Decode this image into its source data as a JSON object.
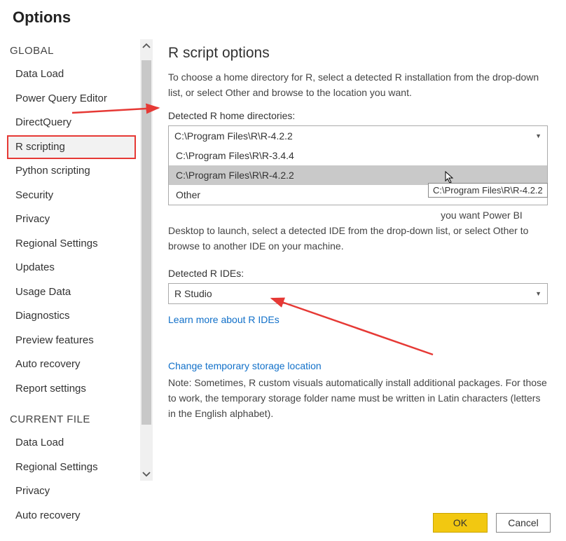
{
  "window_title": "Options",
  "sidebar": {
    "sections": [
      {
        "header": "GLOBAL",
        "items": [
          {
            "label": "Data Load",
            "selected": false
          },
          {
            "label": "Power Query Editor",
            "selected": false
          },
          {
            "label": "DirectQuery",
            "selected": false
          },
          {
            "label": "R scripting",
            "selected": true
          },
          {
            "label": "Python scripting",
            "selected": false
          },
          {
            "label": "Security",
            "selected": false
          },
          {
            "label": "Privacy",
            "selected": false
          },
          {
            "label": "Regional Settings",
            "selected": false
          },
          {
            "label": "Updates",
            "selected": false
          },
          {
            "label": "Usage Data",
            "selected": false
          },
          {
            "label": "Diagnostics",
            "selected": false
          },
          {
            "label": "Preview features",
            "selected": false
          },
          {
            "label": "Auto recovery",
            "selected": false
          },
          {
            "label": "Report settings",
            "selected": false
          }
        ]
      },
      {
        "header": "CURRENT FILE",
        "items": [
          {
            "label": "Data Load",
            "selected": false
          },
          {
            "label": "Regional Settings",
            "selected": false
          },
          {
            "label": "Privacy",
            "selected": false
          },
          {
            "label": "Auto recovery",
            "selected": false
          }
        ]
      }
    ]
  },
  "panel": {
    "title": "R script options",
    "intro": "To choose a home directory for R, select a detected R installation from the drop-down list, or select Other and browse to the location you want.",
    "home_dir_label": "Detected R home directories:",
    "home_dir_value": "C:\\Program Files\\R\\R-4.2.2",
    "home_dir_options": [
      "C:\\Program Files\\R\\R-3.4.4",
      "C:\\Program Files\\R\\R-4.2.2",
      "Other"
    ],
    "tooltip": "C:\\Program Files\\R\\R-4.2.2",
    "ide_intro": "To choose which R integrated development environment (IDE) you want Power BI Desktop to launch, select a detected IDE from the drop-down list, or select Other to browse to another IDE on your machine.",
    "ide_label": "Detected R IDEs:",
    "ide_value": "R Studio",
    "ide_link": "Learn more about R IDEs",
    "storage_link": "Change temporary storage location",
    "storage_note": "Note: Sometimes, R custom visuals automatically install additional packages. For those to work, the temporary storage folder name must be written in Latin characters (letters in the English alphabet)."
  },
  "buttons": {
    "ok": "OK",
    "cancel": "Cancel"
  }
}
